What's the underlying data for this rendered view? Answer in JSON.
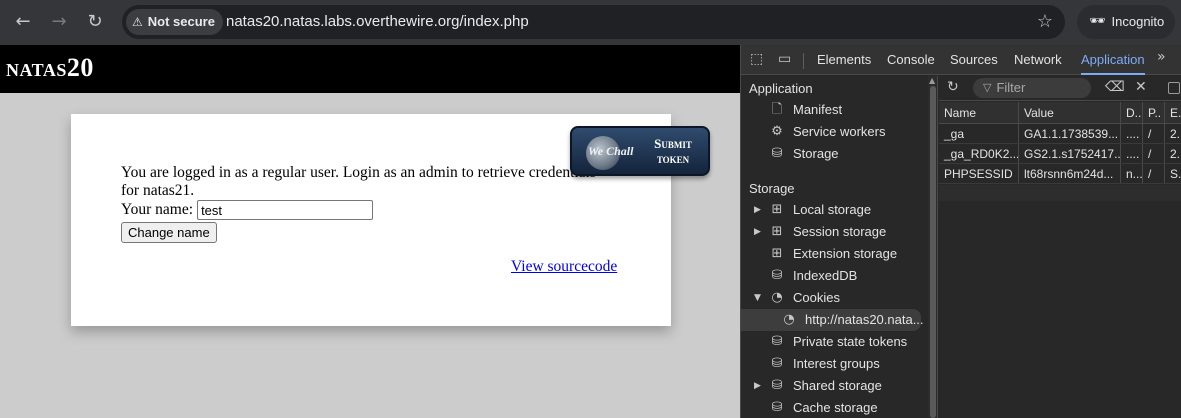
{
  "browser": {
    "security_label": "Not secure",
    "url": "natas20.natas.labs.overthewire.org/index.php",
    "incognito_label": "Incognito",
    "icons": [
      "back-icon",
      "forward-icon",
      "reload-icon",
      "warning-icon",
      "star-icon",
      "incognito-icon"
    ]
  },
  "page": {
    "level_title": "natas20",
    "message": "You are logged in as a regular user. Login as an admin to retrieve credentials for natas21.",
    "name_label": "Your name:",
    "name_value": "test",
    "change_button": "Change name",
    "source_link": "View sourcecode",
    "wechall": {
      "logo_text": "We Chall",
      "submit_line1": "Submit",
      "submit_line2": "token"
    },
    "colors": {
      "header": "#000000",
      "background": "#cccccc",
      "link": "#0000ee"
    }
  },
  "devtools": {
    "tabs": [
      "Elements",
      "Console",
      "Sources",
      "Network",
      "Application"
    ],
    "active_tab": "Application",
    "more_tabs_icon": "chevron-double-right-icon",
    "sidebar": {
      "application_heading": "Application",
      "application_items": [
        {
          "label": "Manifest",
          "icon": "document-icon"
        },
        {
          "label": "Service workers",
          "icon": "gear-icon"
        },
        {
          "label": "Storage",
          "icon": "database-icon"
        }
      ],
      "storage_heading": "Storage",
      "storage_items": [
        {
          "label": "Local storage",
          "icon": "table-icon",
          "expandable": true
        },
        {
          "label": "Session storage",
          "icon": "table-icon",
          "expandable": true
        },
        {
          "label": "Extension storage",
          "icon": "table-icon",
          "expandable": false
        },
        {
          "label": "IndexedDB",
          "icon": "database-icon",
          "expandable": false
        },
        {
          "label": "Cookies",
          "icon": "cookie-icon",
          "expandable": true,
          "expanded": true
        },
        {
          "label": "http://natas20.nata...",
          "icon": "cookie-icon",
          "selected": true
        },
        {
          "label": "Private state tokens",
          "icon": "database-icon",
          "expandable": false
        },
        {
          "label": "Interest groups",
          "icon": "database-icon",
          "expandable": false
        },
        {
          "label": "Shared storage",
          "icon": "database-icon",
          "expandable": true
        },
        {
          "label": "Cache storage",
          "icon": "database-icon",
          "expandable": false
        }
      ]
    },
    "toolbar": {
      "filter_placeholder": "Filter"
    },
    "cookies_table": {
      "columns": [
        "Name",
        "Value",
        "D..",
        "P..",
        "E."
      ],
      "rows": [
        {
          "name": "_ga",
          "value": "GA1.1.1738539...",
          "d": "....",
          "p": "/",
          "e": "2."
        },
        {
          "name": "_ga_RD0K2...",
          "value": "GS2.1.s1752417...",
          "d": "....",
          "p": "/",
          "e": "2."
        },
        {
          "name": "PHPSESSID",
          "value": "lt68rsnn6m24d...",
          "d": "n...",
          "p": "/",
          "e": "S."
        }
      ]
    },
    "colors": {
      "accent": "#7cacf8",
      "panel": "#282828"
    }
  }
}
